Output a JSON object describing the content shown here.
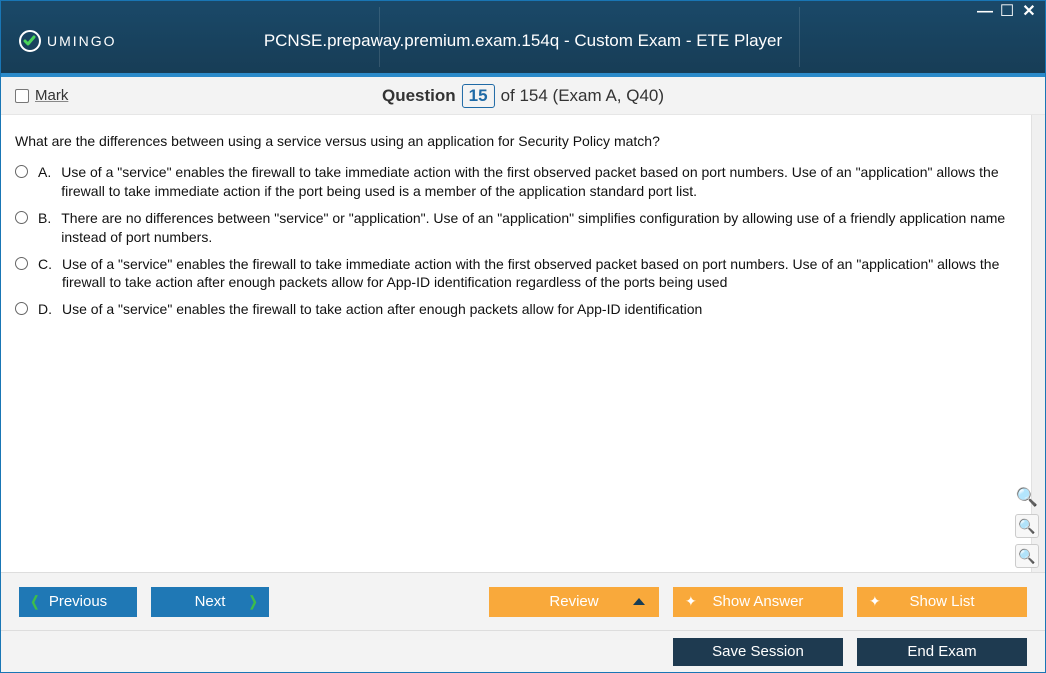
{
  "window": {
    "title": "PCNSE.prepaway.premium.exam.154q - Custom Exam - ETE Player",
    "brand_suffix": "UMINGO"
  },
  "qbar": {
    "mark_label": "Mark",
    "question_word": "Question",
    "current_num": "15",
    "total_text": "of 154 (Exam A, Q40)"
  },
  "question": {
    "text": "What are the differences between using a service versus using an application for Security Policy match?",
    "options": [
      {
        "letter": "A.",
        "text": "Use of a \"service\" enables the firewall to take immediate action with the first observed packet based on port numbers. Use of an \"application\" allows the firewall to take immediate action if the port being used is a member of the application standard port list."
      },
      {
        "letter": "B.",
        "text": "There are no differences between \"service\" or \"application\". Use of an \"application\" simplifies configuration by allowing use of a friendly application name instead of port numbers."
      },
      {
        "letter": "C.",
        "text": "Use of a \"service\" enables the firewall to take immediate action with the first observed packet based on port numbers. Use of an \"application\" allows the firewall to take action after enough packets allow for App-ID identification regardless of the ports being used"
      },
      {
        "letter": "D.",
        "text": "Use of a \"service\" enables the firewall to take action after enough packets allow for App-ID identification"
      }
    ]
  },
  "buttons": {
    "previous": "Previous",
    "next": "Next",
    "review": "Review",
    "show_answer": "Show Answer",
    "show_list": "Show List",
    "save_session": "Save Session",
    "end_exam": "End Exam"
  }
}
